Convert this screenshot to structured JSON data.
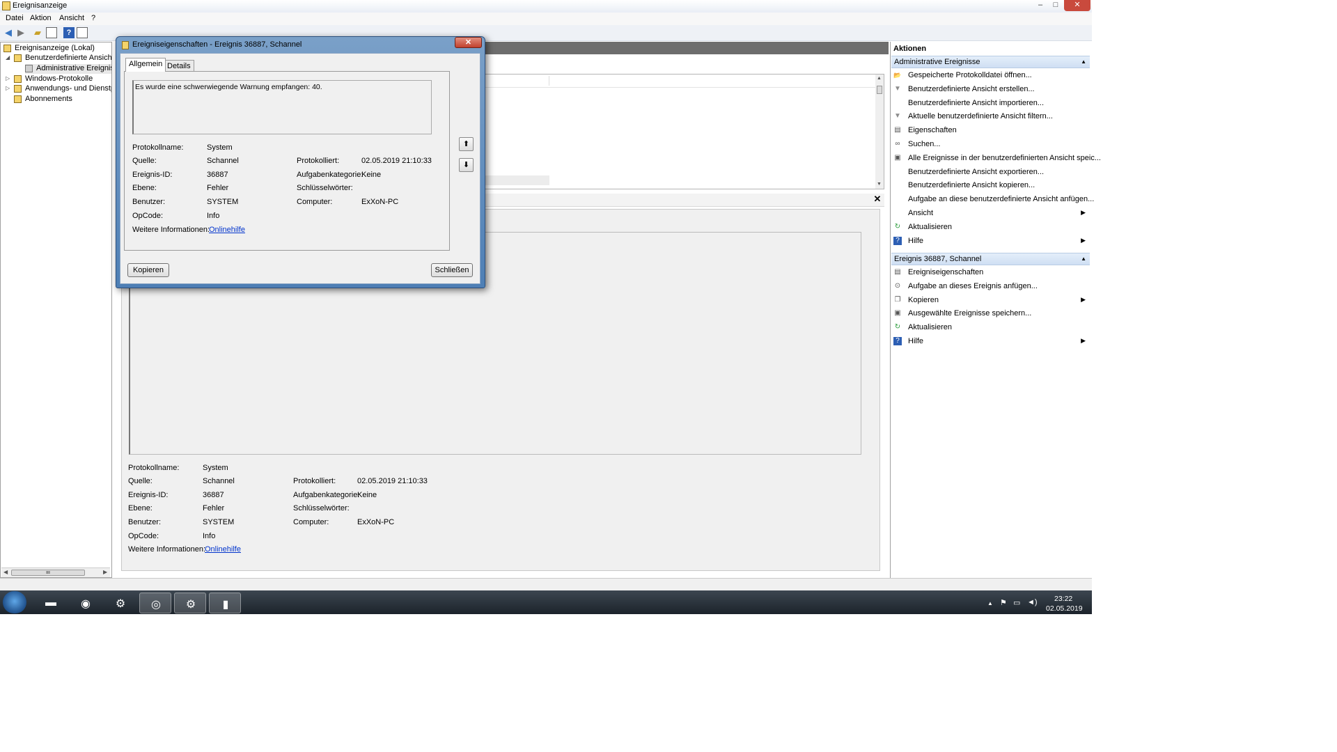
{
  "window": {
    "title": "Ereignisanzeige",
    "btn_min": "–",
    "btn_max": "□",
    "btn_close": "✕"
  },
  "menu": [
    "Datei",
    "Aktion",
    "Ansicht",
    "?"
  ],
  "tree": {
    "items": [
      {
        "label": "Ereignisanzeige (Lokal)",
        "arrow": ""
      },
      {
        "label": "Benutzerdefinierte Ansichten",
        "arrow": "◢"
      },
      {
        "label": "Administrative Ereignisse",
        "arrow": ""
      },
      {
        "label": "Windows-Protokolle",
        "arrow": "▷"
      },
      {
        "label": "Anwendungs- und Dienstprotokolle",
        "arrow": "▷"
      },
      {
        "label": "Abonnements",
        "arrow": ""
      }
    ]
  },
  "details_panel": {
    "rows": [
      {
        "label": "Protokollname:",
        "value": "System"
      },
      {
        "label": "Quelle:",
        "value": "Schannel",
        "label2": "Protokolliert:",
        "value2": "02.05.2019 21:10:33"
      },
      {
        "label": "Ereignis-ID:",
        "value": "36887",
        "label2": "Aufgabenkategorie:",
        "value2": "Keine"
      },
      {
        "label": "Ebene:",
        "value": "Fehler",
        "label2": "Schlüsselwörter:",
        "value2": ""
      },
      {
        "label": "Benutzer:",
        "value": "SYSTEM",
        "label2": "Computer:",
        "value2": "ExXoN-PC"
      },
      {
        "label": "OpCode:",
        "value": "Info"
      },
      {
        "label": "Weitere Informationen:",
        "link": "Onlinehilfe"
      }
    ],
    "close_glyph": "✕"
  },
  "dialog": {
    "title": "Ereigniseigenschaften - Ereignis 36887, Schannel",
    "close": "✕",
    "tabs": [
      "Allgemein",
      "Details"
    ],
    "message": "Es wurde eine schwerwiegende Warnung empfangen: 40.",
    "nav_up": "⬆",
    "nav_down": "⬇",
    "rows": [
      {
        "label": "Protokollname:",
        "value": "System"
      },
      {
        "label": "Quelle:",
        "value": "Schannel",
        "label2": "Protokolliert:",
        "value2": "02.05.2019 21:10:33"
      },
      {
        "label": "Ereignis-ID:",
        "value": "36887",
        "label2": "Aufgabenkategorie:",
        "value2": "Keine"
      },
      {
        "label": "Ebene:",
        "value": "Fehler",
        "label2": "Schlüsselwörter:",
        "value2": ""
      },
      {
        "label": "Benutzer:",
        "value": "SYSTEM",
        "label2": "Computer:",
        "value2": "ExXoN-PC"
      },
      {
        "label": "OpCode:",
        "value": "Info"
      },
      {
        "label": "Weitere Informationen:",
        "link": "Onlinehilfe"
      }
    ],
    "copy_button": "Kopieren",
    "close_button": "Schließen"
  },
  "actions": {
    "title": "Aktionen",
    "section1": {
      "title": "Administrative Ereignisse",
      "items": [
        {
          "label": "Gespeicherte Protokolldatei öffnen...",
          "icon": "folder-open-icon",
          "glyph": "📂"
        },
        {
          "label": "Benutzerdefinierte Ansicht erstellen...",
          "icon": "filter-icon",
          "glyph": "▼"
        },
        {
          "label": "Benutzerdefinierte Ansicht importieren...",
          "icon": "",
          "glyph": ""
        },
        {
          "label": "Aktuelle benutzerdefinierte Ansicht filtern...",
          "icon": "filter-icon",
          "glyph": "▼"
        },
        {
          "label": "Eigenschaften",
          "icon": "properties-icon",
          "glyph": "▤"
        },
        {
          "label": "Suchen...",
          "icon": "binoculars-icon",
          "glyph": "∞"
        },
        {
          "label": "Alle Ereignisse in der benutzerdefinierten Ansicht speic...",
          "icon": "save-icon",
          "glyph": "▣"
        },
        {
          "label": "Benutzerdefinierte Ansicht exportieren...",
          "icon": "",
          "glyph": ""
        },
        {
          "label": "Benutzerdefinierte Ansicht kopieren...",
          "icon": "",
          "glyph": ""
        },
        {
          "label": "Aufgabe an diese benutzerdefinierte Ansicht anfügen...",
          "icon": "",
          "glyph": ""
        },
        {
          "label": "Ansicht",
          "icon": "",
          "glyph": "",
          "submenu": true
        },
        {
          "label": "Aktualisieren",
          "icon": "refresh-icon",
          "glyph": "↻"
        },
        {
          "label": "Hilfe",
          "icon": "help-icon",
          "glyph": "?",
          "submenu": true
        }
      ]
    },
    "section2": {
      "title": "Ereignis 36887, Schannel",
      "items": [
        {
          "label": "Ereigniseigenschaften",
          "icon": "properties-icon",
          "glyph": "▤"
        },
        {
          "label": "Aufgabe an dieses Ereignis anfügen...",
          "icon": "task-icon",
          "glyph": "⊙"
        },
        {
          "label": "Kopieren",
          "icon": "copy-icon",
          "glyph": "❐",
          "submenu": true
        },
        {
          "label": "Ausgewählte Ereignisse speichern...",
          "icon": "save-icon",
          "glyph": "▣"
        },
        {
          "label": "Aktualisieren",
          "icon": "refresh-icon",
          "glyph": "↻"
        },
        {
          "label": "Hilfe",
          "icon": "help-icon",
          "glyph": "?",
          "submenu": true
        }
      ]
    },
    "submenu_arrow": "▶",
    "collapse_caret": "▲"
  },
  "taskbar": {
    "apps": [
      {
        "name": "explorer",
        "glyph": "▬"
      },
      {
        "name": "headset-app",
        "glyph": "◉"
      },
      {
        "name": "steam",
        "glyph": "⚙"
      },
      {
        "name": "chrome",
        "glyph": "◎"
      },
      {
        "name": "steam-active",
        "glyph": "⚙"
      },
      {
        "name": "event-viewer",
        "glyph": "▮"
      }
    ],
    "tray_up": "▲",
    "clock_time": "23:22",
    "clock_date": "02.05.2019"
  },
  "colors": {
    "accent": "#4e7fb5",
    "link": "#0033cc",
    "section_head": "#cfdff3"
  }
}
